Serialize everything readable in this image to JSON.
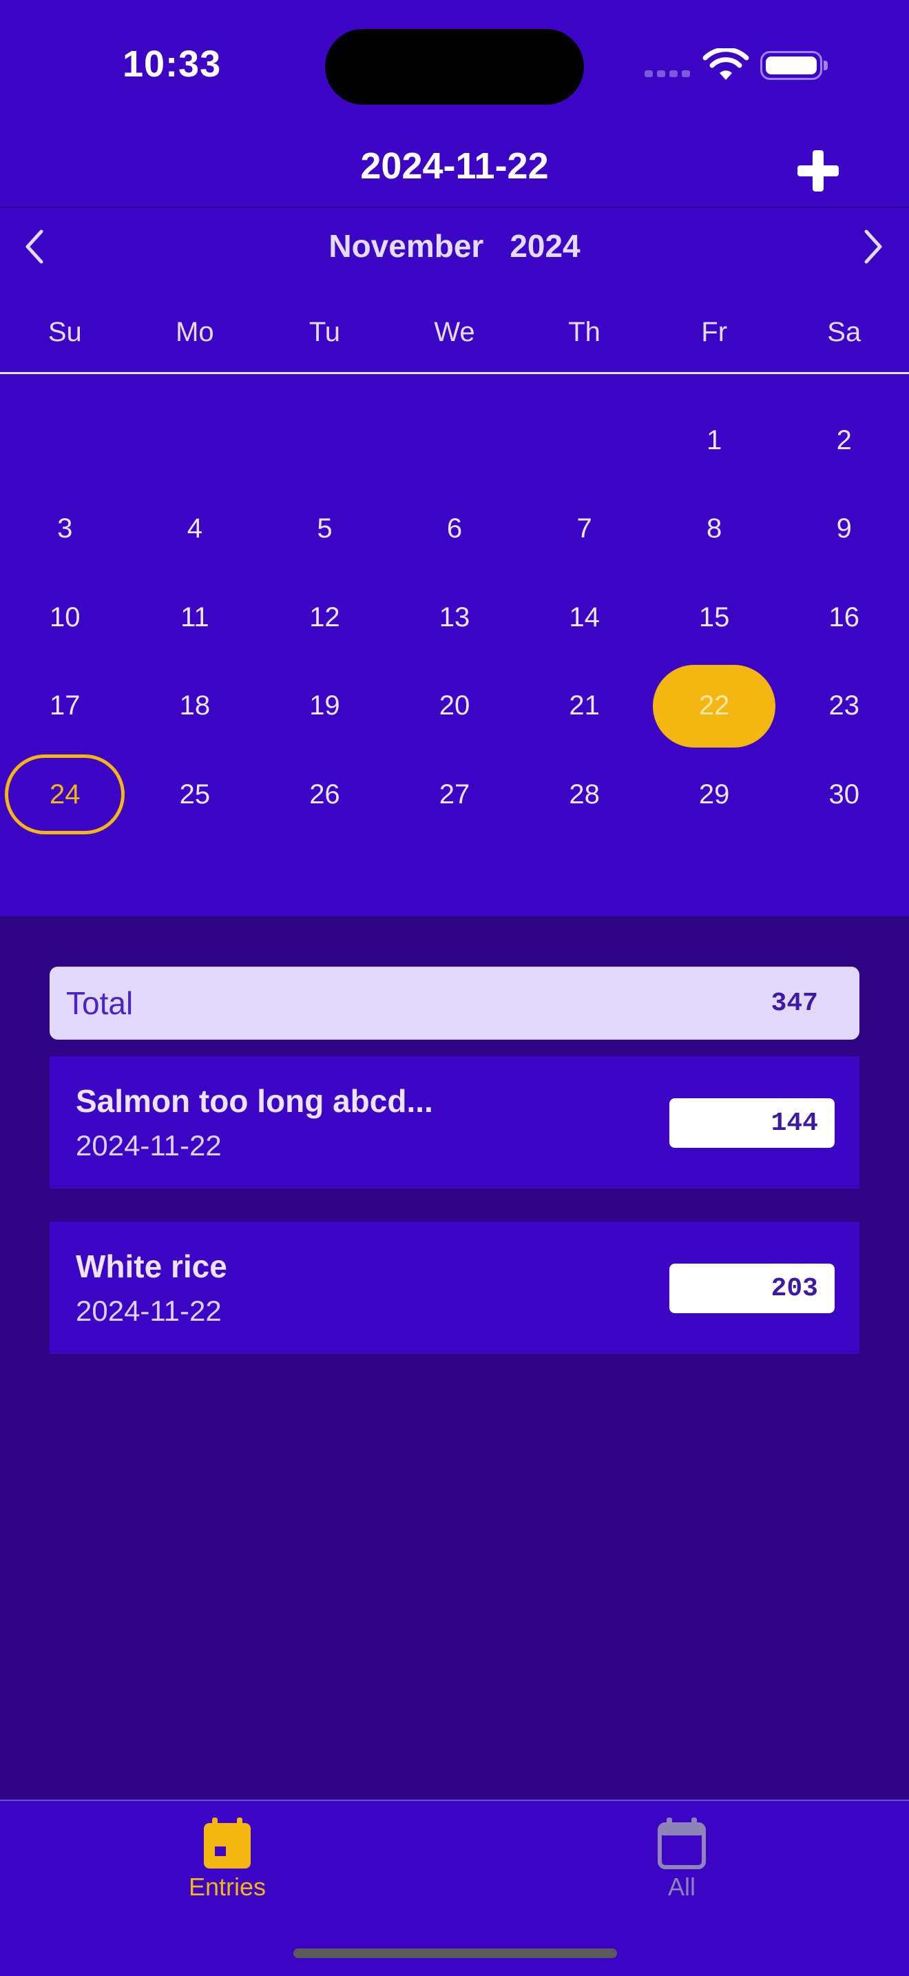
{
  "status_bar": {
    "time": "10:33"
  },
  "nav": {
    "title": "2024-11-22",
    "add_icon": "plus-icon"
  },
  "calendar": {
    "month": "November",
    "year": "2024",
    "weekdays": [
      "Su",
      "Mo",
      "Tu",
      "We",
      "Th",
      "Fr",
      "Sa"
    ],
    "weeks": [
      [
        "",
        "",
        "",
        "",
        "",
        "1",
        "2"
      ],
      [
        "3",
        "4",
        "5",
        "6",
        "7",
        "8",
        "9"
      ],
      [
        "10",
        "11",
        "12",
        "13",
        "14",
        "15",
        "16"
      ],
      [
        "17",
        "18",
        "19",
        "20",
        "21",
        "22",
        "23"
      ],
      [
        "24",
        "25",
        "26",
        "27",
        "28",
        "29",
        "30"
      ]
    ],
    "selected_day": "22",
    "today_day": "24"
  },
  "summary": {
    "label": "Total",
    "value": "347"
  },
  "entries": [
    {
      "name": "Salmon too long abcd...",
      "date": "2024-11-22",
      "value": "144"
    },
    {
      "name": "White rice",
      "date": "2024-11-22",
      "value": "203"
    }
  ],
  "tabs": [
    {
      "label": "Entries",
      "icon": "calendar-icon",
      "active": true
    },
    {
      "label": "All",
      "icon": "calendar-icon",
      "active": false
    }
  ],
  "colors": {
    "accent": "#f4b610",
    "primary": "#3c04c4",
    "background": "#2d0585"
  }
}
